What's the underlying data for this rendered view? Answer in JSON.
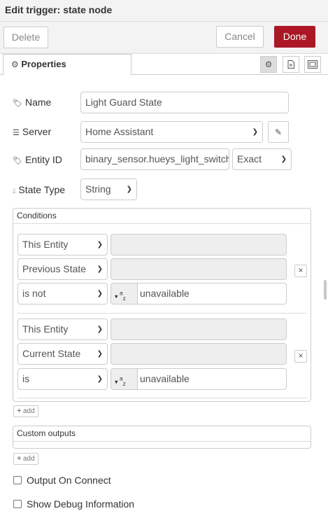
{
  "header": {
    "title": "Edit trigger: state node"
  },
  "toolbar": {
    "delete_label": "Delete",
    "cancel_label": "Cancel",
    "done_label": "Done"
  },
  "tabs": {
    "properties_label": "Properties"
  },
  "form": {
    "name_label": "Name",
    "name_value": "Light Guard State",
    "server_label": "Server",
    "server_value": "Home Assistant",
    "entity_label": "Entity ID",
    "entity_value": "binary_sensor.hueys_light_switch",
    "match_value": "Exact",
    "state_type_label": "State Type",
    "state_type_value": "String"
  },
  "conditions": {
    "title": "Conditions",
    "groups": [
      {
        "target": "This Entity",
        "property": "Previous State",
        "comparator": "is not",
        "type_glyph": "a",
        "type_glyph_sub": "z",
        "value": "unavailable"
      },
      {
        "target": "This Entity",
        "property": "Current State",
        "comparator": "is",
        "type_glyph": "a",
        "type_glyph_sub": "z",
        "value": "unavailable"
      }
    ],
    "add_label": "add"
  },
  "custom_outputs": {
    "title": "Custom outputs",
    "add_label": "add"
  },
  "options": {
    "output_on_connect": "Output On Connect",
    "show_debug": "Show Debug Information"
  }
}
